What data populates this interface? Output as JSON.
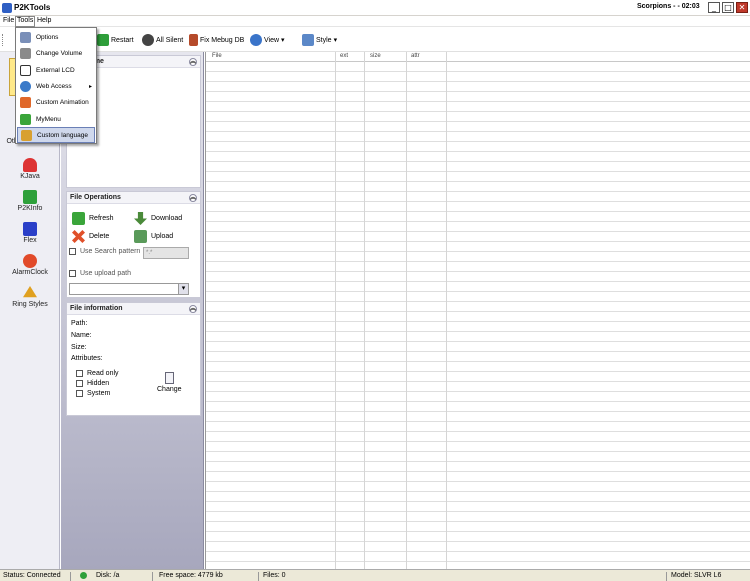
{
  "window": {
    "title": "P2KTools",
    "phone": "Scorpions - - 02:03",
    "minimize": "_",
    "maximize": "□",
    "close": "✕"
  },
  "menubar": {
    "file": "File",
    "tools": "Tools",
    "help": "Help"
  },
  "toolbar": {
    "restart": "Restart",
    "all_silent": "All Silent",
    "fix_mebug": "Fix Mebug DB",
    "view": "View",
    "style": "Style",
    "arrow": "▾"
  },
  "tools_menu": {
    "items": [
      {
        "label": "Options",
        "icon": "options-icon"
      },
      {
        "label": "Change Volume",
        "icon": "volume-icon"
      },
      {
        "label": "External LCD",
        "icon": "lcd-icon"
      },
      {
        "label": "Web Access",
        "icon": "web-icon",
        "submenu": "▸"
      },
      {
        "label": "Custom Animation",
        "icon": "animation-icon"
      },
      {
        "label": "MyMenu",
        "icon": "mymenu-icon"
      },
      {
        "label": "Custom language",
        "icon": "language-icon"
      }
    ]
  },
  "leftnav": {
    "items": [
      {
        "label": "Other Features"
      },
      {
        "label": "KJava"
      },
      {
        "label": "P2KInfo"
      },
      {
        "label": "Flex"
      },
      {
        "label": "AlarmClock"
      },
      {
        "label": "Ring Styles"
      }
    ]
  },
  "tree_panel": {
    "title": "...me",
    "collapse": "︽"
  },
  "file_operations": {
    "title": "File Operations",
    "collapse": "︽",
    "refresh": "Refresh",
    "download": "Download",
    "delete": "Delete",
    "upload": "Upload",
    "use_search_pattern": "Use Search pattern",
    "search_value": "*.*",
    "use_upload_path": "Use upload path",
    "combo_arrow": "▾"
  },
  "file_information": {
    "title": "File information",
    "collapse": "︽",
    "path": "Path:",
    "name": "Name:",
    "size": "Size:",
    "attributes": "Attributes:",
    "read_only": "Read only",
    "hidden": "Hidden",
    "system": "System",
    "change": "Change"
  },
  "file_list": {
    "columns": [
      "File",
      "ext",
      "size",
      "attr"
    ]
  },
  "statusbar": {
    "status": "Status: Connected",
    "disk": "Disk: /a",
    "free_space": "Free space: 4779 kb",
    "files": "Files: 0",
    "model": "Model: SLVR L6"
  },
  "colors": {
    "accent_highlight": "#cfd8ec",
    "panel_gradient_top": "#e6e6ee",
    "panel_gradient_bottom": "#a7a7bd"
  }
}
